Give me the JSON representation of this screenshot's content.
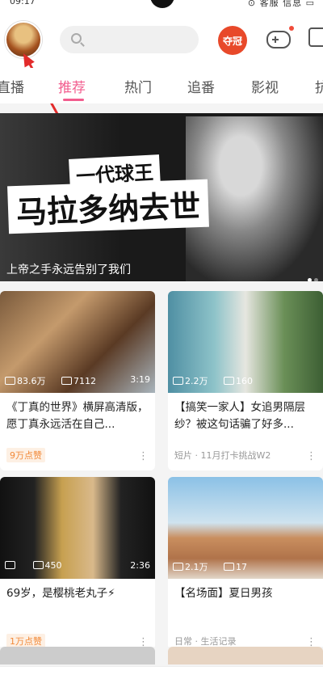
{
  "status": {
    "time": "09:17",
    "right": "⊙ 客服 信息 ▭"
  },
  "header": {
    "badge_label": "夺冠"
  },
  "tabs": [
    "直播",
    "推荐",
    "热门",
    "追番",
    "影视",
    "抗"
  ],
  "banner": {
    "headline_top": "一代球王",
    "headline_main": "马拉多纳去世",
    "caption": "上帝之手永远告别了我们"
  },
  "cards": [
    {
      "views": "83.6万",
      "danmaku": "7112",
      "duration": "3:19",
      "title": "《丁真的世界》横屏高清版，愿丁真永远活在自己...",
      "tag": "9万点赞",
      "subtitle": ""
    },
    {
      "views": "2.2万",
      "danmaku": "160",
      "duration": "",
      "title": "【搞笑一家人】女追男隔层纱？被这句话骗了好多...",
      "tag": "",
      "subtitle": "短片 · 11月打卡挑战W2"
    },
    {
      "views": "",
      "danmaku": "450",
      "duration": "2:36",
      "title": "69岁，是樱桃老丸子⚡",
      "tag": "1万点赞",
      "subtitle": ""
    },
    {
      "views": "2.1万",
      "danmaku": "17",
      "duration": "",
      "title": "【名场面】夏日男孩",
      "tag": "",
      "subtitle": "日常 · 生活记录"
    }
  ],
  "colors": {
    "accent": "#f25d8e",
    "tag_text": "#f28a3a",
    "badge": "#e8492a"
  }
}
